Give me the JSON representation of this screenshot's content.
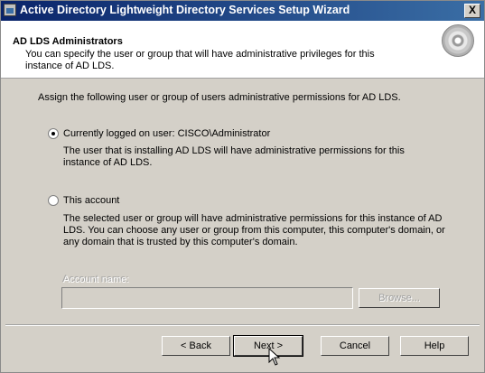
{
  "window": {
    "title": "Active Directory Lightweight Directory Services Setup Wizard",
    "close_label": "X"
  },
  "header": {
    "title": "AD LDS Administrators",
    "subtitle": "You can specify the user or group that will have administrative privileges for this instance of AD LDS."
  },
  "body": {
    "instruction": "Assign the following user or group of users administrative permissions for AD LDS.",
    "option_current": {
      "label": "Currently logged on user: CISCO\\Administrator",
      "description": "The user that is installing AD LDS will have administrative permissions for this instance of AD LDS.",
      "selected": true
    },
    "option_account": {
      "label": "This account",
      "description": "The selected user or group will have administrative permissions for this instance of AD LDS. You can choose any user or group from this computer, this computer's domain, or any domain that is trusted by this computer's domain.",
      "selected": false
    },
    "account_name_label": "Account name:",
    "account_name_value": "",
    "browse_label": "Browse..."
  },
  "footer": {
    "back_label": "< Back",
    "next_label": "Next >",
    "cancel_label": "Cancel",
    "help_label": "Help"
  }
}
